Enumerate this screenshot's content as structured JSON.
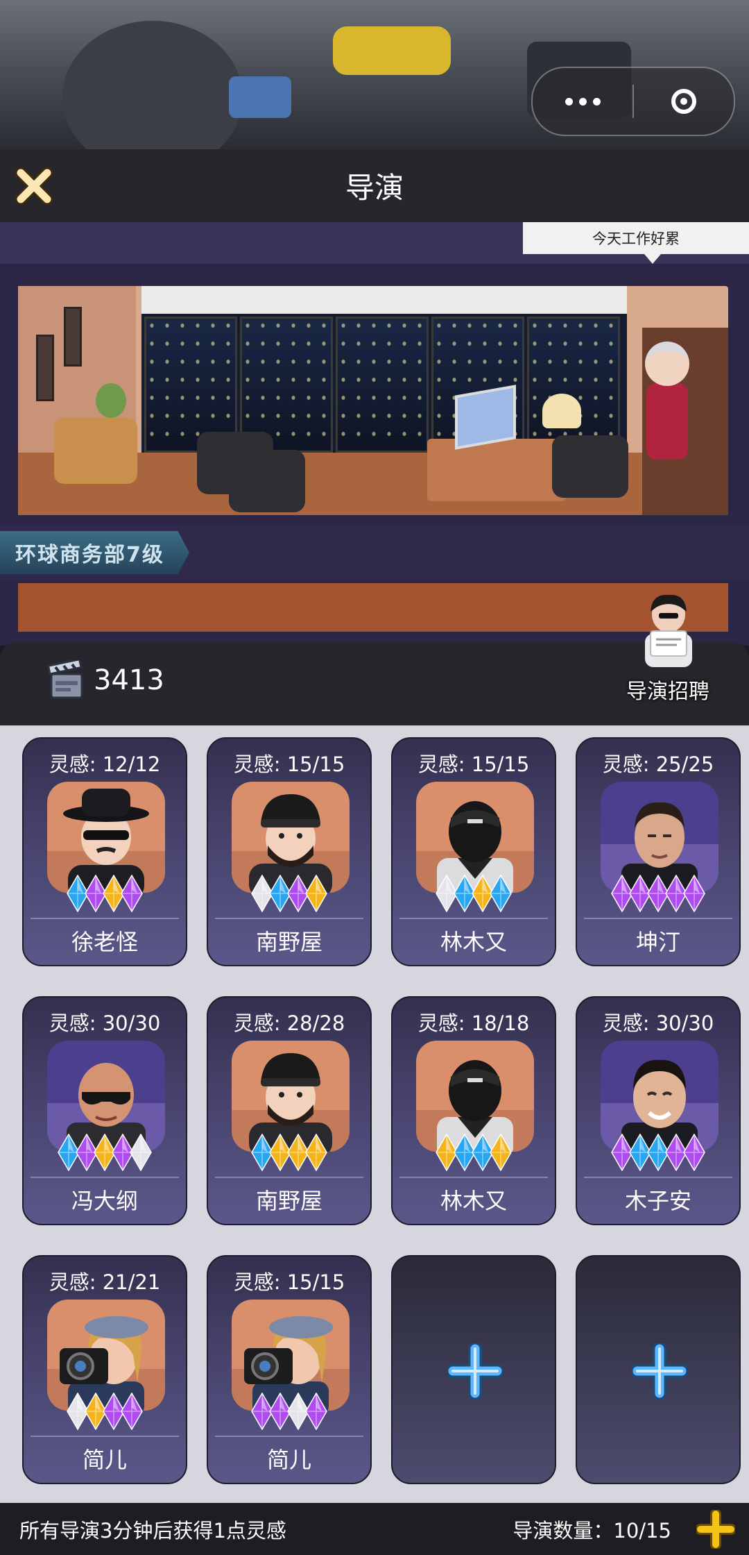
{
  "screen": {
    "title": "导演"
  },
  "office": {
    "speech_bubble": "今天工作好累",
    "department_banner": "环球商务部7级"
  },
  "resources": {
    "clapper_count": "3413"
  },
  "recruit": {
    "label": "导演招聘",
    "icon": "recruiter-icon"
  },
  "directors": [
    {
      "name": "徐老怪",
      "inspiration": "灵感: 12/12",
      "gems": [
        "blue",
        "purple",
        "gold",
        "purple"
      ],
      "avatar": "hat-sunglasses"
    },
    {
      "name": "南野屋",
      "inspiration": "灵感: 15/15",
      "gems": [
        "white",
        "blue",
        "purple",
        "gold"
      ],
      "avatar": "beanie-beard"
    },
    {
      "name": "林木又",
      "inspiration": "灵感: 15/15",
      "gems": [
        "white",
        "blue",
        "gold",
        "blue"
      ],
      "avatar": "cap-back"
    },
    {
      "name": "坤汀",
      "inspiration": "灵感: 25/25",
      "gems": [
        "purple",
        "purple",
        "purple",
        "purple",
        "purple"
      ],
      "avatar": "realistic-man"
    },
    {
      "name": "冯大纲",
      "inspiration": "灵感: 30/30",
      "gems": [
        "blue",
        "purple",
        "gold",
        "purple",
        "white"
      ],
      "avatar": "bald-sunglasses"
    },
    {
      "name": "南野屋",
      "inspiration": "灵感: 28/28",
      "gems": [
        "blue",
        "gold",
        "gold",
        "gold"
      ],
      "avatar": "beanie-beard"
    },
    {
      "name": "林木又",
      "inspiration": "灵感: 18/18",
      "gems": [
        "gold",
        "blue",
        "blue",
        "gold"
      ],
      "avatar": "cap-back"
    },
    {
      "name": "木子安",
      "inspiration": "灵感: 30/30",
      "gems": [
        "purple",
        "blue",
        "blue",
        "purple",
        "purple"
      ],
      "avatar": "realistic-smile"
    },
    {
      "name": "简儿",
      "inspiration": "灵感: 21/21",
      "gems": [
        "white",
        "gold",
        "purple",
        "purple"
      ],
      "avatar": "camera-woman"
    },
    {
      "name": "简儿",
      "inspiration": "灵感: 15/15",
      "gems": [
        "purple",
        "purple",
        "white",
        "purple"
      ],
      "avatar": "camera-woman"
    }
  ],
  "empty_slots": 2,
  "footer": {
    "info": "所有导演3分钟后获得1点灵感",
    "director_count": "导演数量：10/15"
  },
  "colors": {
    "gem_blue": "#27a6f2",
    "gem_purple": "#b04bf0",
    "gem_gold": "#f5b51a",
    "gem_white": "#e4e4ea",
    "plus_blue": "#5fb6ff",
    "footer_plus": "#f3c316"
  }
}
